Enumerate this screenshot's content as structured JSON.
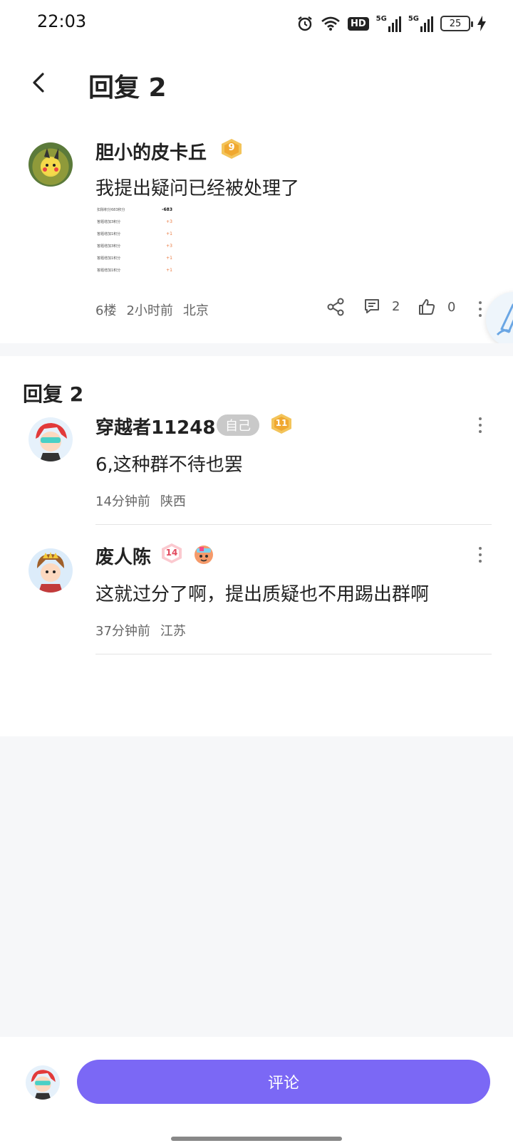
{
  "status_bar": {
    "time": "22:03",
    "battery": "25",
    "network1": "5G",
    "network2": "5G",
    "hd": "HD"
  },
  "header": {
    "title": "回复 2"
  },
  "post": {
    "username": "胆小的皮卡丘",
    "level": "9",
    "content": "我提出疑问已经被处理了",
    "floor": "6楼",
    "time": "2小时前",
    "location": "北京",
    "comment_count": "2",
    "like_count": "0",
    "thumbnail_rows": [
      {
        "label": "扣除积分683积分",
        "value": "-683"
      },
      {
        "label": "答题增加3积分",
        "value": "+3"
      },
      {
        "label": "答题增加1积分",
        "value": "+1"
      },
      {
        "label": "答题增加3积分",
        "value": "+3"
      },
      {
        "label": "答题增加1积分",
        "value": "+1"
      },
      {
        "label": "答题增加1积分",
        "value": "+1"
      }
    ]
  },
  "replies_section": {
    "title": "回复 2"
  },
  "replies": [
    {
      "username": "穿越者11248",
      "self_badge": "自己",
      "level": "11",
      "content": "6,这种群不待也罢",
      "time": "14分钟前",
      "location": "陕西"
    },
    {
      "username": "废人陈",
      "level": "14",
      "content": "这就过分了啊，提出质疑也不用踢出群啊",
      "time": "37分钟前",
      "location": "江苏"
    }
  ],
  "bottom_bar": {
    "comment_button": "评论"
  },
  "colors": {
    "accent": "#7b68f5",
    "level_badge": "#f0a830",
    "level14_badge": "#f06a78"
  }
}
